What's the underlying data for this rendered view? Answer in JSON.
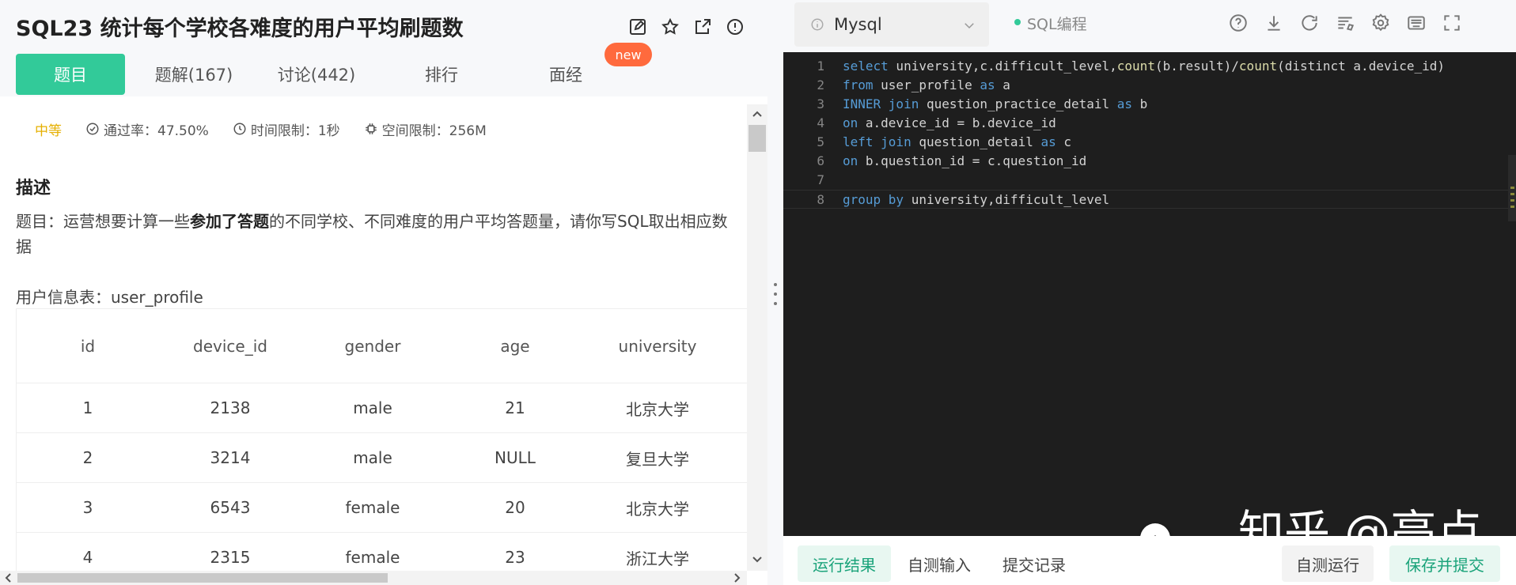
{
  "problem": {
    "title": "SQL23  统计每个学校各难度的用户平均刷题数",
    "tabs": [
      {
        "label": "题目",
        "active": true
      },
      {
        "label": "题解(167)",
        "active": false
      },
      {
        "label": "讨论(442)",
        "active": false
      },
      {
        "label": "排行",
        "active": false
      },
      {
        "label": "面经",
        "active": false
      }
    ],
    "new_badge": "new",
    "meta": {
      "difficulty": "中等",
      "pass_rate": "通过率：47.50%",
      "time_limit": "时间限制：1秒",
      "space_limit": "空间限制：256M"
    },
    "description": {
      "heading": "描述",
      "text_before": "题目：运营想要计算一些",
      "text_bold": "参加了答题",
      "text_after": "的不同学校、不同难度的用户平均答题量，请你写SQL取出相应数据",
      "table_caption": "用户信息表：user_profile"
    },
    "table": {
      "columns": [
        "id",
        "device_id",
        "gender",
        "age",
        "university"
      ],
      "rows": [
        [
          "1",
          "2138",
          "male",
          "21",
          "北京大学"
        ],
        [
          "2",
          "3214",
          "male",
          "NULL",
          "复旦大学"
        ],
        [
          "3",
          "6543",
          "female",
          "20",
          "北京大学"
        ],
        [
          "4",
          "2315",
          "female",
          "23",
          "浙江大学"
        ]
      ]
    }
  },
  "editor": {
    "language": "Mysql",
    "mode_label": "SQL编程",
    "toolbar_icons": [
      "help-icon",
      "download-icon",
      "refresh-icon",
      "format-icon",
      "settings-icon",
      "keyboard-icon",
      "fullscreen-icon"
    ],
    "lines": [
      {
        "n": "1",
        "tokens": [
          [
            "kw",
            "select"
          ],
          [
            "t",
            " university,c.difficult_level,"
          ],
          [
            "fn",
            "count"
          ],
          [
            "t",
            "(b.result)/"
          ],
          [
            "fn",
            "count"
          ],
          [
            "t",
            "(distinct a.device_id)"
          ]
        ]
      },
      {
        "n": "2",
        "tokens": [
          [
            "kw",
            "from"
          ],
          [
            "t",
            " user_profile "
          ],
          [
            "kw",
            "as"
          ],
          [
            "t",
            " a"
          ]
        ]
      },
      {
        "n": "3",
        "tokens": [
          [
            "kw",
            "INNER join"
          ],
          [
            "t",
            " question_practice_detail "
          ],
          [
            "kw",
            "as"
          ],
          [
            "t",
            " b"
          ]
        ]
      },
      {
        "n": "4",
        "tokens": [
          [
            "kw",
            "on"
          ],
          [
            "t",
            " a.device_id = b.device_id"
          ]
        ]
      },
      {
        "n": "5",
        "tokens": [
          [
            "kw",
            "left join"
          ],
          [
            "t",
            " question_detail "
          ],
          [
            "kw",
            "as"
          ],
          [
            "t",
            " c"
          ]
        ]
      },
      {
        "n": "6",
        "tokens": [
          [
            "kw",
            "on"
          ],
          [
            "t",
            " b.question_id = c.question_id"
          ]
        ]
      },
      {
        "n": "7",
        "tokens": []
      },
      {
        "n": "8",
        "tokens": [
          [
            "kw",
            "group by"
          ],
          [
            "t",
            " university,difficult_level"
          ]
        ]
      }
    ],
    "current_line": 8,
    "watermark": "知乎 @亮点"
  },
  "bottom": {
    "tabs": [
      {
        "label": "运行结果",
        "active": true
      },
      {
        "label": "自测输入",
        "active": false
      },
      {
        "label": "提交记录",
        "active": false
      }
    ],
    "self_run": "自测运行",
    "submit": "保存并提交"
  },
  "colors": {
    "accent": "#32ca99",
    "badge": "#ff6a3d",
    "difficulty": "#e6b000",
    "editor_bg": "#1e1e1e"
  }
}
